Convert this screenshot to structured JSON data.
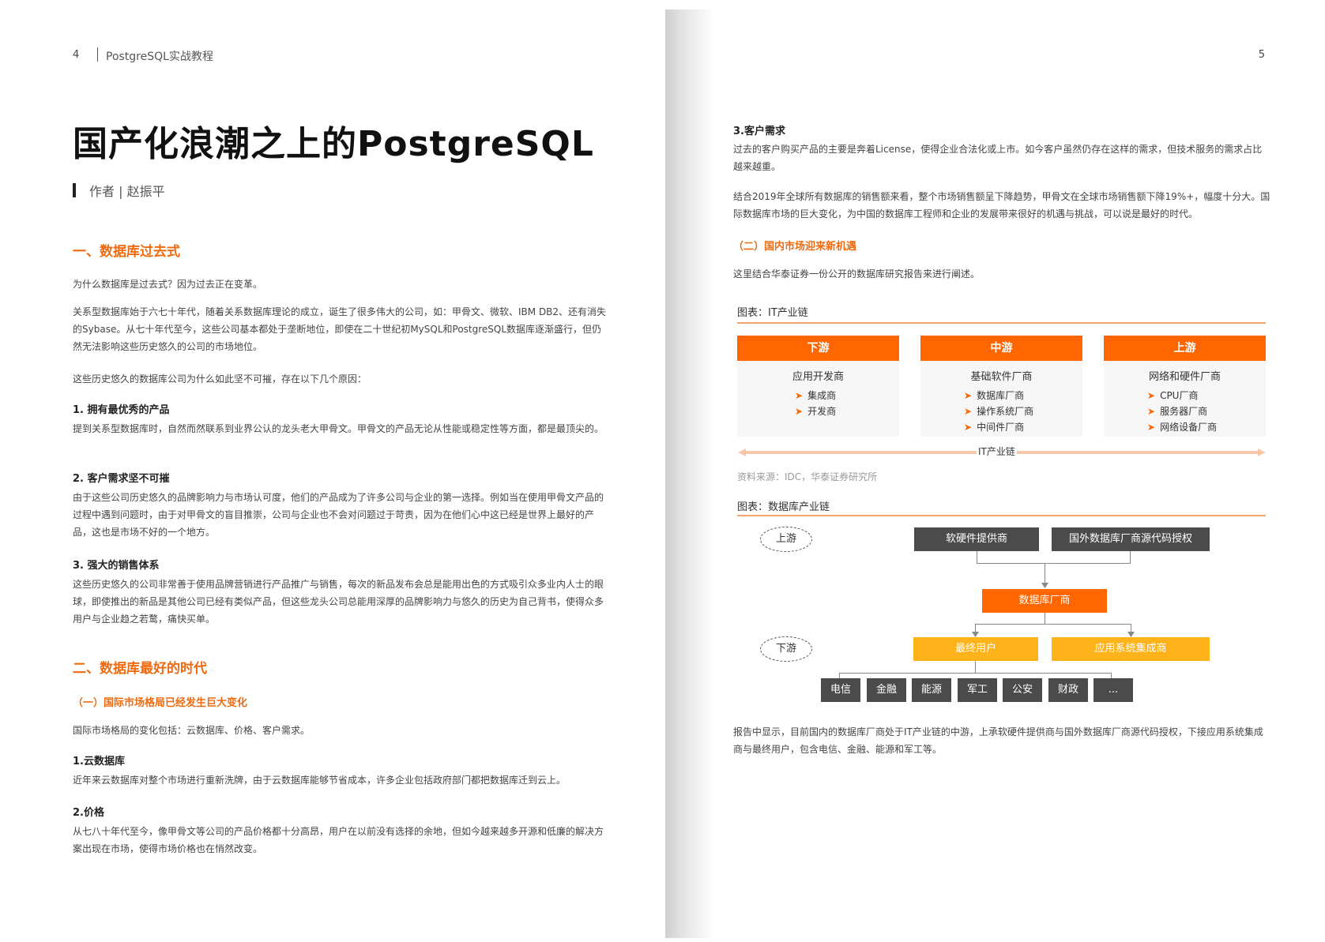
{
  "left_page": {
    "page_number": "4",
    "header_title": "PostgreSQL实战教程",
    "title": "国产化浪潮之上的PostgreSQL",
    "author": "作者 | 赵振平",
    "section1": {
      "title": "一、数据库过去式",
      "p1": "为什么数据库是过去式？因为过去正在变革。",
      "p2": "关系型数据库始于六七十年代，随着关系数据库理论的成立，诞生了很多伟大的公司，如：甲骨文、微软、IBM DB2、还有消失的Sybase。从七十年代至今，这些公司基本都处于垄断地位，即使在二十世纪初MySQL和PostgreSQL数据库逐渐盛行，但仍然无法影响这些历史悠久的公司的市场地位。",
      "p3": "这些历史悠久的数据库公司为什么如此坚不可摧，存在以下几个原因：",
      "h1": "1. 拥有最优秀的产品",
      "t1": "提到关系型数据库时，自然而然联系到业界公认的龙头老大甲骨文。甲骨文的产品无论从性能或稳定性等方面，都是最顶尖的。",
      "h2": "2. 客户需求坚不可摧",
      "t2": "由于这些公司历史悠久的品牌影响力与市场认可度，他们的产品成为了许多公司与企业的第一选择。例如当在使用甲骨文产品的过程中遇到问题时，由于对甲骨文的盲目推崇，公司与企业也不会对问题过于苛责，因为在他们心中这已经是世界上最好的产品，这也是市场不好的一个地方。",
      "h3": "3. 强大的销售体系",
      "t3": "这些历史悠久的公司非常善于使用品牌营销进行产品推广与销售，每次的新品发布会总是能用出色的方式吸引众多业内人士的眼球，即使推出的新品是其他公司已经有类似产品，但这些龙头公司总能用深厚的品牌影响力与悠久的历史为自己背书，使得众多用户与企业趋之若鹜，痛快买单。"
    },
    "section2": {
      "title": "二、数据库最好的时代",
      "sub1": "（一）国际市场格局已经发生巨大变化",
      "p1": "国际市场格局的变化包括：云数据库、价格、客户需求。",
      "h1": "1.云数据库",
      "t1": "近年来云数据库对整个市场进行重新洗牌，由于云数据库能够节省成本，许多企业包括政府部门都把数据库迁到云上。",
      "h2": "2.价格",
      "t2": "从七八十年代至今，像甲骨文等公司的产品价格都十分高昂，用户在以前没有选择的余地，但如今越来越多开源和低廉的解决方案出现在市场，使得市场价格也在悄然改变。"
    }
  },
  "right_page": {
    "page_number": "5",
    "h3": "3.客户需求",
    "t3": "过去的客户购买产品的主要是奔着License，使得企业合法化或上市。如今客户虽然仍存在这样的需求，但技术服务的需求占比越来越重。",
    "p_sales": "结合2019年全球所有数据库的销售额来看，整个市场销售额呈下降趋势，甲骨文在全球市场销售额下降19%+，幅度十分大。国际数据库市场的巨大变化，为中国的数据库工程师和企业的发展带来很好的机遇与挑战，可以说是最好的时代。",
    "sub2": "（二）国内市场迎来新机遇",
    "p_intro": "这里结合华泰证券一份公开的数据库研究报告来进行阐述。",
    "fig1": {
      "caption": "图表：IT产业链",
      "columns": [
        {
          "head": "下游",
          "sub": "应用开发商",
          "items": [
            "集成商",
            "开发商"
          ]
        },
        {
          "head": "中游",
          "sub": "基础软件厂商",
          "items": [
            "数据库厂商",
            "操作系统厂商",
            "中间件厂商"
          ]
        },
        {
          "head": "上游",
          "sub": "网络和硬件厂商",
          "items": [
            "CPU厂商",
            "服务器厂商",
            "网络设备厂商"
          ]
        }
      ],
      "chain_label": "IT产业链",
      "source": "资料来源：IDC，华泰证券研究所"
    },
    "fig2": {
      "caption": "图表：数据库产业链",
      "upstream_label": "上游",
      "downstream_label": "下游",
      "box_hw": "软硬件提供商",
      "box_foreign": "国外数据库厂商源代码授权",
      "box_db": "数据库厂商",
      "box_enduser": "最终用户",
      "box_integrator": "应用系统集成商",
      "industries": [
        "电信",
        "金融",
        "能源",
        "军工",
        "公安",
        "财政",
        "..."
      ]
    },
    "p_report": "报告中显示，目前国内的数据库厂商处于IT产业链的中游，上承软硬件提供商与国外数据库厂商源代码授权，下接应用系统集成商与最终用户，包含电信、金融、能源和军工等。"
  },
  "colors": {
    "accent": "#ff6600",
    "accent_text": "#ee6a10",
    "yellow": "#ffb31a",
    "dark_box": "#4b4b4b"
  }
}
